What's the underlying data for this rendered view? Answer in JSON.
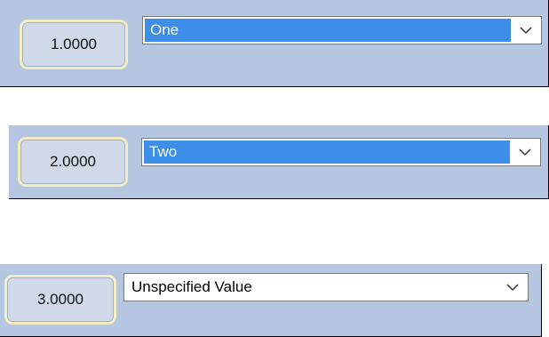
{
  "rows": [
    {
      "value": "1.0000",
      "selection": "One",
      "highlighted": true
    },
    {
      "value": "2.0000",
      "selection": "Two",
      "highlighted": true
    },
    {
      "value": "3.0000",
      "selection": "Unspecified Value",
      "highlighted": false
    }
  ],
  "colors": {
    "panel_background": "#b4c6e0",
    "value_box_background": "#cfd9e8",
    "value_box_border": "#f4edc4",
    "selection_highlight": "#3d8ee8"
  },
  "icons": {
    "dropdown": "chevron-down-icon"
  }
}
